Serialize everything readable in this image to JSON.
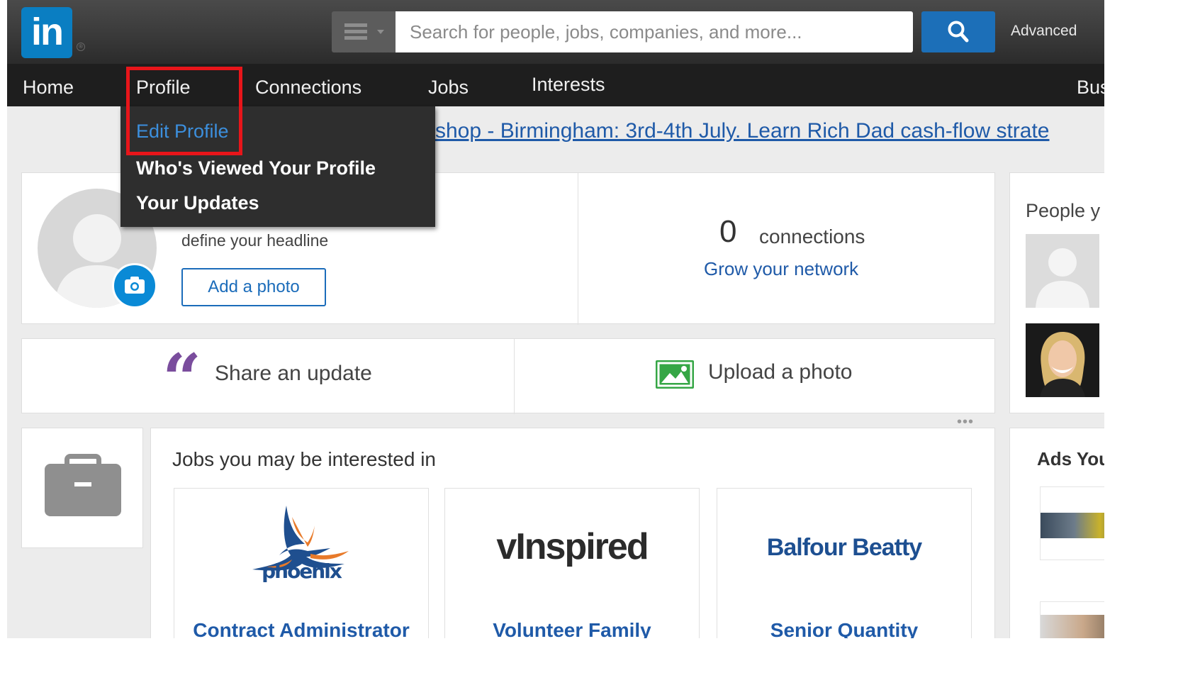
{
  "header": {
    "logo_text": "in",
    "search_placeholder": "Search for people, jobs, companies, and more...",
    "advanced_label": "Advanced"
  },
  "nav": {
    "items": [
      {
        "label": "Home"
      },
      {
        "label": "Profile"
      },
      {
        "label": "Connections"
      },
      {
        "label": "Jobs"
      },
      {
        "label": "Interests"
      },
      {
        "label": "Bus"
      }
    ]
  },
  "profile_menu": {
    "items": [
      {
        "label": "Edit Profile"
      },
      {
        "label": "Who's Viewed Your Profile"
      },
      {
        "label": "Your Updates"
      }
    ]
  },
  "banner": {
    "link_text": "shop - Birmingham: 3rd-4th July. Learn Rich Dad cash-flow strate"
  },
  "profile_card": {
    "headline_prompt": "define your headline",
    "add_photo_label": "Add a photo",
    "connections_count": "0",
    "connections_label": "connections",
    "grow_network_label": "Grow your network"
  },
  "share": {
    "share_label": "Share an update",
    "upload_label": "Upload a photo",
    "more_label": "•••"
  },
  "jobs": {
    "title": "Jobs you may be interested in",
    "cards": [
      {
        "company_logo_text": "phoenix",
        "job_title": "Contract Administrator"
      },
      {
        "company_logo_text": "vInspired",
        "job_title": "Volunteer Family"
      },
      {
        "company_logo_text": "Balfour Beatty",
        "job_title": "Senior Quantity"
      }
    ]
  },
  "sidebar": {
    "people_title": "People y",
    "ads_title": "Ads You"
  },
  "colors": {
    "brand_blue": "#0a7ec2",
    "link_blue": "#1f5aa8",
    "highlight_red": "#e8151a",
    "quote_purple": "#7a4d9d",
    "photo_green": "#35a645"
  }
}
